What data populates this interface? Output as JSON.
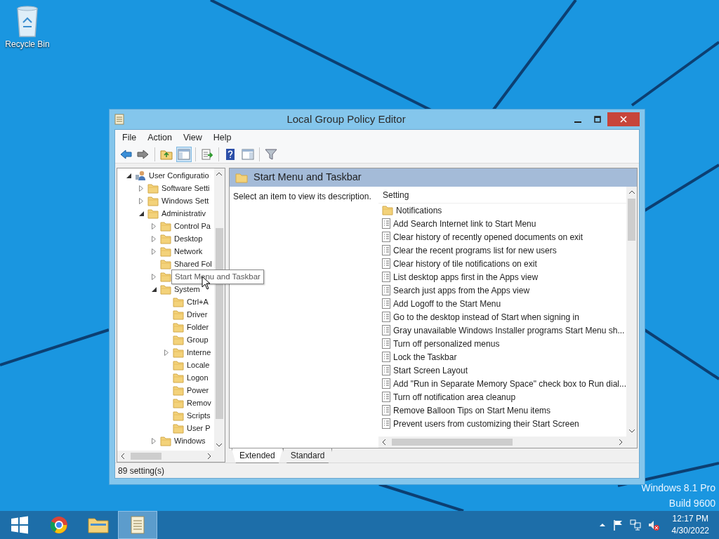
{
  "desktop": {
    "icons": [
      {
        "label": "Recycle Bin"
      }
    ],
    "watermark": [
      "Windows 8.1 Pro",
      "Build 9600"
    ]
  },
  "window": {
    "title": "Local Group Policy Editor"
  },
  "menu": [
    "File",
    "Action",
    "View",
    "Help"
  ],
  "toolbar": [
    {
      "kind": "back",
      "pressed": false
    },
    {
      "kind": "forward",
      "pressed": false
    },
    {
      "kind": "sep"
    },
    {
      "kind": "up",
      "pressed": false
    },
    {
      "kind": "tree",
      "pressed": true
    },
    {
      "kind": "sep"
    },
    {
      "kind": "export",
      "pressed": false
    },
    {
      "kind": "sep"
    },
    {
      "kind": "help",
      "pressed": false
    },
    {
      "kind": "pane",
      "pressed": false
    },
    {
      "kind": "sep"
    },
    {
      "kind": "filter",
      "pressed": false
    }
  ],
  "tree": [
    {
      "kind": "user",
      "label": "User Configuratio",
      "expanded": true,
      "children": [
        {
          "kind": "folder",
          "label": "Software Setti",
          "expanded": false
        },
        {
          "kind": "folder",
          "label": "Windows Sett",
          "expanded": false
        },
        {
          "kind": "folder",
          "label": "Administrativ",
          "expanded": true,
          "children": [
            {
              "kind": "folder",
              "label": "Control Pa",
              "expanded": false
            },
            {
              "kind": "folder",
              "label": "Desktop",
              "expanded": false
            },
            {
              "kind": "folder",
              "label": "Network",
              "expanded": false
            },
            {
              "kind": "folder",
              "label": "Shared Fol"
            },
            {
              "kind": "folder",
              "tooltip": "Start Menu and Taskbar",
              "expanded": false
            },
            {
              "kind": "folder",
              "label": "System",
              "expanded": true,
              "children": [
                {
                  "kind": "folder",
                  "label": "Ctrl+A"
                },
                {
                  "kind": "folder",
                  "label": "Driver"
                },
                {
                  "kind": "folder",
                  "label": "Folder"
                },
                {
                  "kind": "folder",
                  "label": "Group"
                },
                {
                  "kind": "folder",
                  "label": "Interne",
                  "expanded": false
                },
                {
                  "kind": "folder",
                  "label": "Locale"
                },
                {
                  "kind": "folder",
                  "label": "Logon"
                },
                {
                  "kind": "folder",
                  "label": "Power"
                },
                {
                  "kind": "folder",
                  "label": "Remov"
                },
                {
                  "kind": "folder",
                  "label": "Scripts"
                },
                {
                  "kind": "folder",
                  "label": "User P"
                }
              ]
            },
            {
              "kind": "folder",
              "label": "Windows",
              "expanded": false
            }
          ]
        }
      ]
    }
  ],
  "details": {
    "header": "Start Menu and Taskbar",
    "description": "Select an item to view its description.",
    "column": "Setting",
    "items": [
      {
        "kind": "folder",
        "label": "Notifications"
      },
      {
        "kind": "policy",
        "label": "Add Search Internet link to Start Menu"
      },
      {
        "kind": "policy",
        "label": "Clear history of recently opened documents on exit"
      },
      {
        "kind": "policy",
        "label": "Clear the recent programs list for new users"
      },
      {
        "kind": "policy",
        "label": "Clear history of tile notifications on exit"
      },
      {
        "kind": "policy",
        "label": "List desktop apps first in the Apps view"
      },
      {
        "kind": "policy",
        "label": "Search just apps from the Apps view"
      },
      {
        "kind": "policy",
        "label": "Add Logoff to the Start Menu"
      },
      {
        "kind": "policy",
        "label": "Go to the desktop instead of Start when signing in"
      },
      {
        "kind": "policy",
        "label": "Gray unavailable Windows Installer programs Start Menu sh..."
      },
      {
        "kind": "policy",
        "label": "Turn off personalized menus"
      },
      {
        "kind": "policy",
        "label": "Lock the Taskbar"
      },
      {
        "kind": "policy",
        "label": "Start Screen Layout"
      },
      {
        "kind": "policy",
        "label": "Add \"Run in Separate Memory Space\" check box to Run dial..."
      },
      {
        "kind": "policy",
        "label": "Turn off notification area cleanup"
      },
      {
        "kind": "policy",
        "label": "Remove Balloon Tips on Start Menu items"
      },
      {
        "kind": "policy",
        "label": "Prevent users from customizing their Start Screen"
      }
    ]
  },
  "tabs": [
    {
      "label": "Extended",
      "selected": true
    },
    {
      "label": "Standard",
      "selected": false
    }
  ],
  "status_bar": "89 setting(s)",
  "taskbar": {
    "apps": [
      {
        "kind": "chrome",
        "active": false
      },
      {
        "kind": "explorer",
        "active": false
      },
      {
        "kind": "gpedit",
        "active": true
      }
    ],
    "time": "12:17 PM",
    "date": "4/30/2022"
  }
}
